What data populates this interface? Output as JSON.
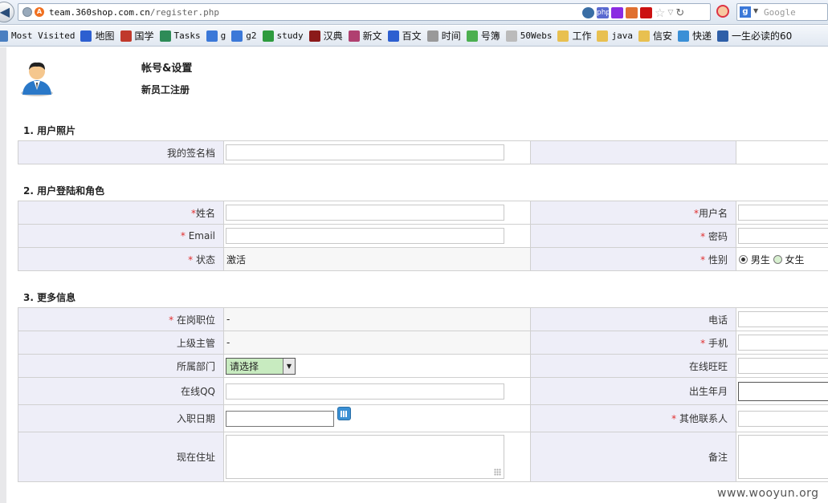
{
  "browser": {
    "url_host": "team.360shop.com.cn",
    "url_path": "/register.php",
    "search_engine_label": "Google",
    "site_icon": "A"
  },
  "bookmarks": [
    {
      "label": "Most Visited",
      "icon": "folder-icon",
      "mono": true,
      "color": "#4a7fc1"
    },
    {
      "label": "地图",
      "icon": "baidu-paw-icon",
      "mono": false,
      "color": "#2d5fd0"
    },
    {
      "label": "国学",
      "icon": "guoxue-icon",
      "mono": false,
      "color": "#c0392b"
    },
    {
      "label": "Tasks",
      "icon": "tasks-icon",
      "mono": true,
      "color": "#2e8b57"
    },
    {
      "label": "g",
      "icon": "google-icon",
      "mono": true,
      "color": "#3b78d8"
    },
    {
      "label": "g2",
      "icon": "google-icon",
      "mono": true,
      "color": "#3b78d8"
    },
    {
      "label": "study",
      "icon": "chat-bubble-icon",
      "mono": true,
      "color": "#2e9b3e"
    },
    {
      "label": "汉典",
      "icon": "handian-icon",
      "mono": false,
      "color": "#8b1a1a"
    },
    {
      "label": "新文",
      "icon": "person-icon",
      "mono": false,
      "color": "#b04070"
    },
    {
      "label": "百文",
      "icon": "baidu-paw-icon",
      "mono": false,
      "color": "#2d5fd0"
    },
    {
      "label": "时间",
      "icon": "clock-icon",
      "mono": false,
      "color": "#999999"
    },
    {
      "label": "号簿",
      "icon": "phonebook-icon",
      "mono": false,
      "color": "#4caf50"
    },
    {
      "label": "50Webs",
      "icon": "page-icon",
      "mono": true,
      "color": "#bbbbbb"
    },
    {
      "label": "工作",
      "icon": "folder-icon",
      "mono": false,
      "color": "#e8c050"
    },
    {
      "label": "java",
      "icon": "folder-icon",
      "mono": true,
      "color": "#e8c050"
    },
    {
      "label": "信安",
      "icon": "folder-icon",
      "mono": false,
      "color": "#e8c050"
    },
    {
      "label": "快递",
      "icon": "kuaidi-icon",
      "mono": false,
      "color": "#3a8fd6"
    },
    {
      "label": "一生必读的60",
      "icon": "book-e-icon",
      "mono": false,
      "color": "#2f5fa8"
    }
  ],
  "header": {
    "title": "帐号&设置",
    "subtitle": "新员工注册"
  },
  "required_mark": "*",
  "sections": {
    "photo": {
      "title": "1. 用户照片",
      "signature_label": "我的签名档",
      "signature_value": ""
    },
    "login": {
      "title": "2. 用户登陆和角色",
      "name_label": "姓名",
      "username_label": "用户名",
      "email_label": " Email",
      "password_label": " 密码",
      "status_label": " 状态",
      "status_value": "激活",
      "gender_label": " 性别",
      "gender_male": "男生",
      "gender_female": "女生",
      "gender_selected": "男生"
    },
    "more": {
      "title": "3. 更多信息",
      "position_label": " 在岗职位",
      "position_value": "-",
      "phone_label": "电话",
      "supervisor_label": "上级主管",
      "supervisor_value": "-",
      "mobile_label": " 手机",
      "department_label": "所属部门",
      "department_selected": "请选择",
      "wangwang_label": "在线旺旺",
      "qq_label": "在线QQ",
      "birth_label": "出生年月",
      "join_date_label": "入职日期",
      "other_contact_label": " 其他联系人",
      "address_label": "现在住址",
      "notes_label": "备注"
    }
  },
  "watermark": "www.wooyun.org"
}
